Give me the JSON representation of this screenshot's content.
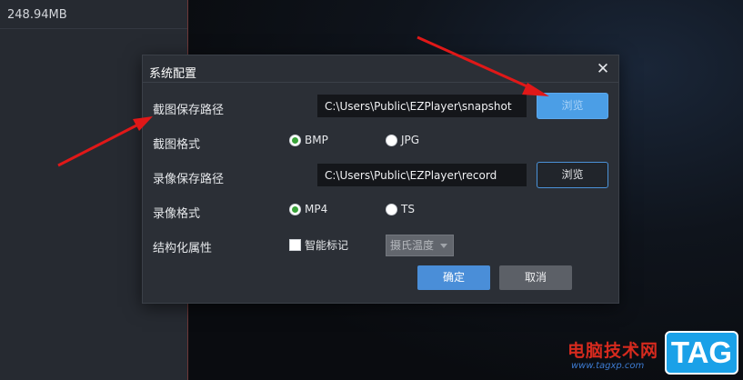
{
  "left_panel": {
    "file_size": "248.94MB"
  },
  "dialog": {
    "title": "系统配置",
    "close_icon": "close-icon",
    "snapshot_path": {
      "label": "截图保存路径",
      "value": "C:\\Users\\Public\\EZPlayer\\snapshot",
      "browse_label": "浏览"
    },
    "snapshot_format": {
      "label": "截图格式",
      "options": [
        "BMP",
        "JPG"
      ],
      "selected": "BMP"
    },
    "record_path": {
      "label": "录像保存路径",
      "value": "C:\\Users\\Public\\EZPlayer\\record",
      "browse_label": "浏览"
    },
    "record_format": {
      "label": "录像格式",
      "options": [
        "MP4",
        "TS"
      ],
      "selected": "MP4"
    },
    "structured": {
      "label": "结构化属性",
      "checkbox_label": "智能标记",
      "checked": false,
      "temperature_select": "摄氏温度"
    },
    "ok_label": "确定",
    "cancel_label": "取消"
  },
  "watermark": {
    "text": "电脑技术网",
    "url": "www.tagxp.com",
    "logo": "TAG"
  },
  "colors": {
    "accent": "#4a8ed8",
    "annotation_arrow": "#e01818",
    "radio_selected": "#3aa33a",
    "watermark_red": "#d62a1e"
  }
}
